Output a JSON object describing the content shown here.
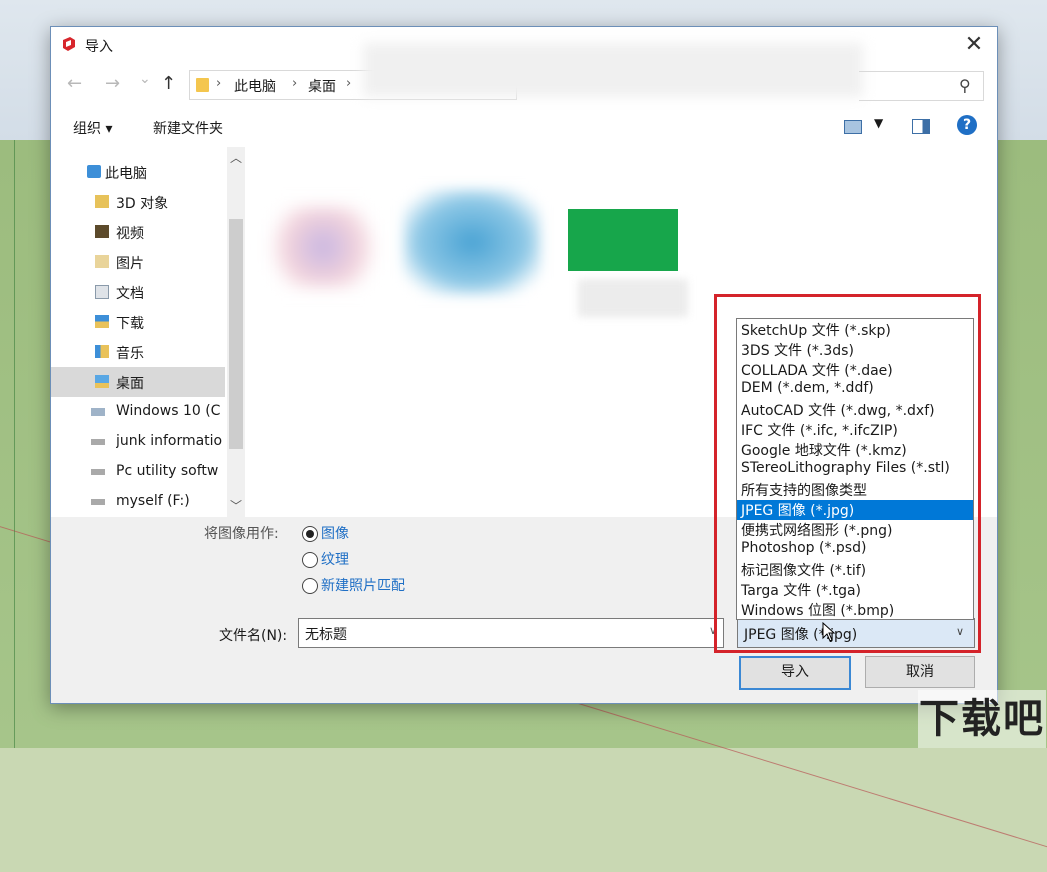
{
  "window": {
    "title": "导入",
    "close_label": "✕"
  },
  "nav": {
    "back_icon": "←",
    "forward_icon": "→",
    "recent_icon": "⌄",
    "up_icon": "↑",
    "breadcrumbs": [
      "此电脑",
      "桌面"
    ],
    "sep": "›"
  },
  "toolbar": {
    "organize_label": "组织 ▾",
    "new_folder_label": "新建文件夹",
    "view_caret": "▼",
    "help_label": "?"
  },
  "sidebar": {
    "items": [
      {
        "label": "此电脑",
        "icon": "pc-icon"
      },
      {
        "label": "3D 对象",
        "icon": "3d-objects-icon"
      },
      {
        "label": "视频",
        "icon": "video-folder-icon"
      },
      {
        "label": "图片",
        "icon": "pictures-folder-icon"
      },
      {
        "label": "文档",
        "icon": "documents-folder-icon"
      },
      {
        "label": "下载",
        "icon": "downloads-folder-icon"
      },
      {
        "label": "音乐",
        "icon": "music-folder-icon"
      },
      {
        "label": "桌面",
        "icon": "desktop-folder-icon"
      },
      {
        "label": "Windows 10 (C",
        "icon": "os-drive-icon"
      },
      {
        "label": "junk informatio",
        "icon": "drive-icon"
      },
      {
        "label": "Pc  utility softw",
        "icon": "drive-icon"
      },
      {
        "label": "myself (F:)",
        "icon": "drive-icon"
      }
    ],
    "selected_index": 7
  },
  "options": {
    "use_as_label": "将图像用作:",
    "radios": [
      {
        "label": "图像",
        "checked": true
      },
      {
        "label": "纹理",
        "checked": false
      },
      {
        "label": "新建照片匹配",
        "checked": false
      }
    ]
  },
  "filename": {
    "label": "文件名(N):",
    "value": "无标题"
  },
  "file_type": {
    "selected": "JPEG 图像 (*.jpg)",
    "options": [
      "SketchUp 文件 (*.skp)",
      "3DS 文件 (*.3ds)",
      "COLLADA 文件 (*.dae)",
      "DEM (*.dem, *.ddf)",
      "AutoCAD 文件 (*.dwg, *.dxf)",
      "IFC 文件 (*.ifc, *.ifcZIP)",
      "Google 地球文件 (*.kmz)",
      "STereoLithography Files (*.stl)",
      "所有支持的图像类型",
      "JPEG 图像 (*.jpg)",
      "便携式网络图形 (*.png)",
      "Photoshop (*.psd)",
      "标记图像文件 (*.tif)",
      "Targa 文件 (*.tga)",
      "Windows 位图 (*.bmp)"
    ],
    "highlighted_index": 9
  },
  "buttons": {
    "import_label": "导入",
    "cancel_label": "取消"
  },
  "colors": {
    "accent": "#0078d7",
    "highlight_border": "#d4232a",
    "link": "#1f6fc5"
  }
}
